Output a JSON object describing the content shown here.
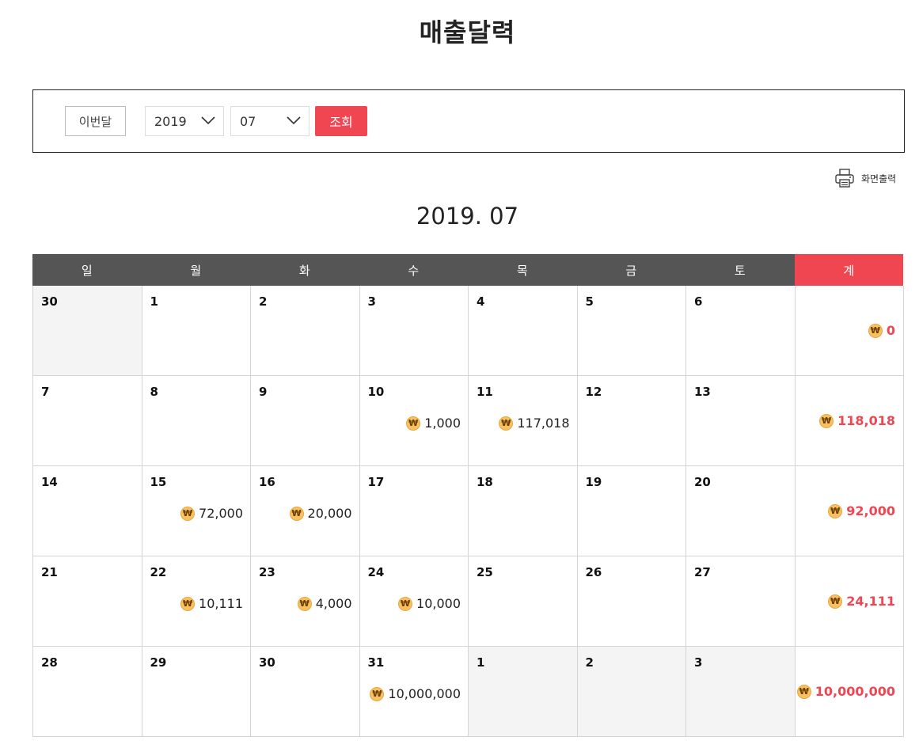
{
  "page": {
    "title": "매출달력"
  },
  "filter": {
    "this_month_label": "이번달",
    "year_value": "2019",
    "month_value": "07",
    "search_label": "조회"
  },
  "print": {
    "label": "화면출력"
  },
  "calendar": {
    "heading": "2019. 07",
    "weekdays": [
      "일",
      "월",
      "화",
      "수",
      "목",
      "금",
      "토"
    ],
    "total_label": "계",
    "currency_symbol": "₩",
    "accent_color": "#f04652",
    "weeks": [
      {
        "days": [
          {
            "d": "30",
            "other": true,
            "amount": ""
          },
          {
            "d": "1",
            "other": false,
            "amount": ""
          },
          {
            "d": "2",
            "other": false,
            "amount": ""
          },
          {
            "d": "3",
            "other": false,
            "amount": ""
          },
          {
            "d": "4",
            "other": false,
            "amount": ""
          },
          {
            "d": "5",
            "other": false,
            "amount": ""
          },
          {
            "d": "6",
            "other": false,
            "amount": ""
          }
        ],
        "total": "0"
      },
      {
        "days": [
          {
            "d": "7",
            "other": false,
            "amount": ""
          },
          {
            "d": "8",
            "other": false,
            "amount": ""
          },
          {
            "d": "9",
            "other": false,
            "amount": ""
          },
          {
            "d": "10",
            "other": false,
            "amount": "1,000"
          },
          {
            "d": "11",
            "other": false,
            "amount": "117,018"
          },
          {
            "d": "12",
            "other": false,
            "amount": ""
          },
          {
            "d": "13",
            "other": false,
            "amount": ""
          }
        ],
        "total": "118,018"
      },
      {
        "days": [
          {
            "d": "14",
            "other": false,
            "amount": ""
          },
          {
            "d": "15",
            "other": false,
            "amount": "72,000"
          },
          {
            "d": "16",
            "other": false,
            "amount": "20,000"
          },
          {
            "d": "17",
            "other": false,
            "amount": ""
          },
          {
            "d": "18",
            "other": false,
            "amount": ""
          },
          {
            "d": "19",
            "other": false,
            "amount": ""
          },
          {
            "d": "20",
            "other": false,
            "amount": ""
          }
        ],
        "total": "92,000"
      },
      {
        "days": [
          {
            "d": "21",
            "other": false,
            "amount": ""
          },
          {
            "d": "22",
            "other": false,
            "amount": "10,111"
          },
          {
            "d": "23",
            "other": false,
            "amount": "4,000"
          },
          {
            "d": "24",
            "other": false,
            "amount": "10,000"
          },
          {
            "d": "25",
            "other": false,
            "amount": ""
          },
          {
            "d": "26",
            "other": false,
            "amount": ""
          },
          {
            "d": "27",
            "other": false,
            "amount": ""
          }
        ],
        "total": "24,111"
      },
      {
        "days": [
          {
            "d": "28",
            "other": false,
            "amount": ""
          },
          {
            "d": "29",
            "other": false,
            "amount": ""
          },
          {
            "d": "30",
            "other": false,
            "amount": ""
          },
          {
            "d": "31",
            "other": false,
            "amount": "10,000,000"
          },
          {
            "d": "1",
            "other": true,
            "amount": ""
          },
          {
            "d": "2",
            "other": true,
            "amount": ""
          },
          {
            "d": "3",
            "other": true,
            "amount": ""
          }
        ],
        "total": "10,000,000"
      }
    ]
  }
}
